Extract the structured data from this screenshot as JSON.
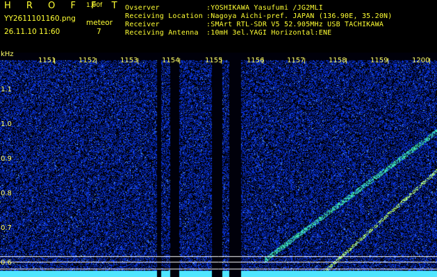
{
  "header": {
    "app_name": "H R O F F T",
    "version": "1.00f",
    "filename": "YY2611101160.png",
    "datetime": "26.11.10 11:60",
    "mode_label": "meteor",
    "meteor_count": "7",
    "info_labels": [
      "Ovserver",
      "Receiving Location",
      "Receiver",
      "Receiving Antenna"
    ],
    "info_values": [
      ":YOSHIKAWA Yasufumi /JG2MLI",
      ":Nagoya Aichi-pref. JAPAN (136.90E, 35.20N)",
      ":SMArt RTL-SDR V5 52.905MHz USB TACHIKAWA",
      ":10mH 3el.YAGI Horizontal:ENE"
    ]
  },
  "plot": {
    "unit": "kHz",
    "y_ticks": [
      "1.1",
      "1.0",
      "0.9",
      "0.8",
      "0.7",
      "0.6"
    ],
    "x_ticks": [
      "1151",
      "1152",
      "1153",
      "1154",
      "1155",
      "1156",
      "1157",
      "1158",
      "1159",
      "1200"
    ],
    "colors": {
      "background": "#000010",
      "noise": "#1a2fd0",
      "signal": "#5cf6ff",
      "text": "#ffff33"
    }
  }
}
